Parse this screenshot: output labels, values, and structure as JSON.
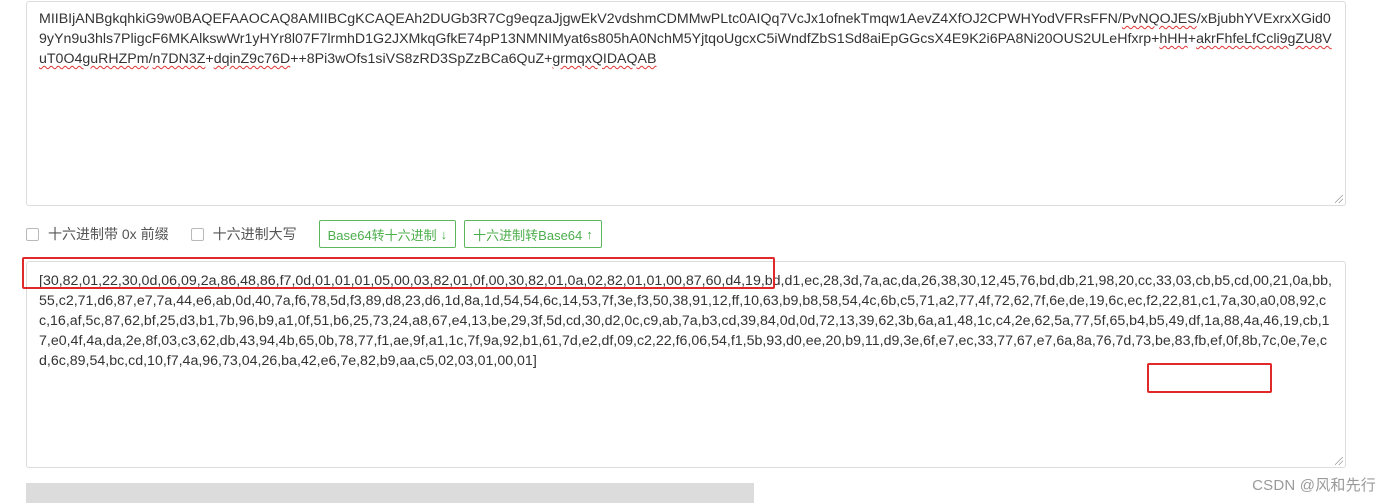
{
  "input": {
    "seg1": "MIIBIjANBgkqhkiG9w0BAQEFAAOCAQ8AMIIBCgKCAQEAh2DUGb3R7Cg9eqzaJjgwEkV2vdshmCDMMwPLtc0AIQq7VcJx1ofnekTmqw1AevZ4XfOJ2CPWHYodVFRsFFN/",
    "seg2": "PvNQOJES",
    "seg3": "/xBjubhYVExrxXGid09yYn9u3hls7PligcF6MKAlkswWr1yHYr8l07F7lrmhD1G2JXMkqGfkE74pP13NMNIMyat6s805hA0NchM5YjtqoUgcxC5iWndfZbS1Sd8aiEpGGcsX4E9K2i6PA8Ni20OUS2ULeHfxrp+",
    "seg4": "hHH",
    "seg5": "+",
    "seg6": "akrFhfeLfCcli9gZU8VuT0O4guRHZPm",
    "seg7": "/",
    "seg8": "n7DN3Z",
    "seg9": "+",
    "seg10": "dqinZ9c76D",
    "seg11": "++8Pi3wOfs1siVS8zRD3SpZzBCa6QuZ",
    "seg12": "+",
    "seg13": "grmqxQIDAQAB"
  },
  "options": {
    "prefix_label": "十六进制带 0x 前缀",
    "upper_label": "十六进制大写"
  },
  "buttons": {
    "b64_to_hex": "Base64转十六进制",
    "b64_to_hex_arrow": "↓",
    "hex_to_b64": "十六进制转Base64",
    "hex_to_b64_arrow": "↑"
  },
  "output": {
    "text": "[30,82,01,22,30,0d,06,09,2a,86,48,86,f7,0d,01,01,01,05,00,03,82,01,0f,00,30,82,01,0a,02,82,01,01,00,87,60,d4,19,bd,d1,ec,28,3d,7a,ac,da,26,38,30,12,45,76,bd,db,21,98,20,cc,33,03,cb,b5,cd,00,21,0a,bb,55,c2,71,d6,87,e7,7a,44,e6,ab,0d,40,7a,f6,78,5d,f3,89,d8,23,d6,1d,8a,1d,54,54,6c,14,53,7f,3e,f3,50,38,91,12,ff,10,63,b9,b8,58,54,4c,6b,c5,71,a2,77,4f,72,62,7f,6e,de,19,6c,ec,f2,22,81,c1,7a,30,a0,08,92,cc,16,af,5c,87,62,bf,25,d3,b1,7b,96,b9,a1,0f,51,b6,25,73,24,a8,67,e4,13,be,29,3f,5d,cd,30,d2,0c,c9,ab,7a,b3,cd,39,84,0d,0d,72,13,39,62,3b,6a,a1,48,1c,c4,2e,62,5a,77,5f,65,b4,b5,49,df,1a,88,4a,46,19,cb,17,e0,4f,4a,da,2e,8f,03,c3,62,db,43,94,4b,65,0b,78,77,f1,ae,9f,a1,1c,7f,9a,92,b1,61,7d,e2,df,09,c2,22,f6,06,54,f1,5b,93,d0,ee,20,b9,11,d9,3e,6f,e7,ec,33,77,67,e7,6a,8a,76,7d,73,be,83,fb,ef,0f,8b,7c,0e,7e,cd,6c,89,54,bc,cd,10,f7,4a,96,73,04,26,ba,42,e6,7e,82,b9,aa,c5,02,03,01,00,01]"
  },
  "watermark": "CSDN @风和先行",
  "colors": {
    "accent_green": "#5cb85c",
    "highlight_red": "#e02a2a"
  }
}
